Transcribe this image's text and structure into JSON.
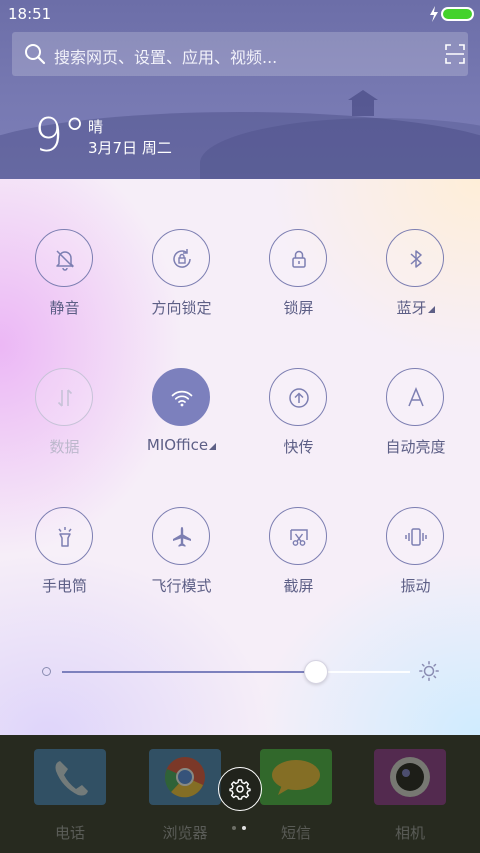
{
  "status_bar": {
    "time": "18:51"
  },
  "search": {
    "placeholder": "搜索网页、设置、应用、视频..."
  },
  "weather": {
    "temperature": "9°",
    "condition": "晴",
    "date": "3月7日 周二"
  },
  "quick_settings": {
    "tiles": [
      {
        "label": "静音",
        "icon": "mute-bell-icon",
        "state": "off"
      },
      {
        "label": "方向锁定",
        "icon": "rotation-lock-icon",
        "state": "off"
      },
      {
        "label": "锁屏",
        "icon": "lock-icon",
        "state": "off"
      },
      {
        "label": "蓝牙",
        "icon": "bluetooth-icon",
        "state": "off",
        "has_menu": true
      },
      {
        "label": "数据",
        "icon": "mobile-data-icon",
        "state": "disabled"
      },
      {
        "label": "MIOffice",
        "icon": "wifi-icon",
        "state": "on",
        "has_menu": true
      },
      {
        "label": "快传",
        "icon": "quick-transfer-icon",
        "state": "off"
      },
      {
        "label": "自动亮度",
        "icon": "auto-brightness-icon",
        "state": "off"
      },
      {
        "label": "手电筒",
        "icon": "flashlight-icon",
        "state": "off"
      },
      {
        "label": "飞行模式",
        "icon": "airplane-icon",
        "state": "off"
      },
      {
        "label": "截屏",
        "icon": "screenshot-icon",
        "state": "off"
      },
      {
        "label": "振动",
        "icon": "vibrate-icon",
        "state": "off"
      }
    ],
    "brightness": {
      "value": 0.73
    }
  },
  "dock": {
    "apps": [
      {
        "label": "电话",
        "icon": "phone-icon"
      },
      {
        "label": "浏览器",
        "icon": "browser-icon"
      },
      {
        "label": "短信",
        "icon": "messages-icon"
      },
      {
        "label": "相机",
        "icon": "camera-icon"
      }
    ],
    "page_indicator": {
      "count": 2,
      "current": 2
    }
  },
  "colors": {
    "header_bg": "#7577b0",
    "accent": "#7c80bd",
    "tile_label": "#5d5f86",
    "battery": "#44d22c"
  }
}
